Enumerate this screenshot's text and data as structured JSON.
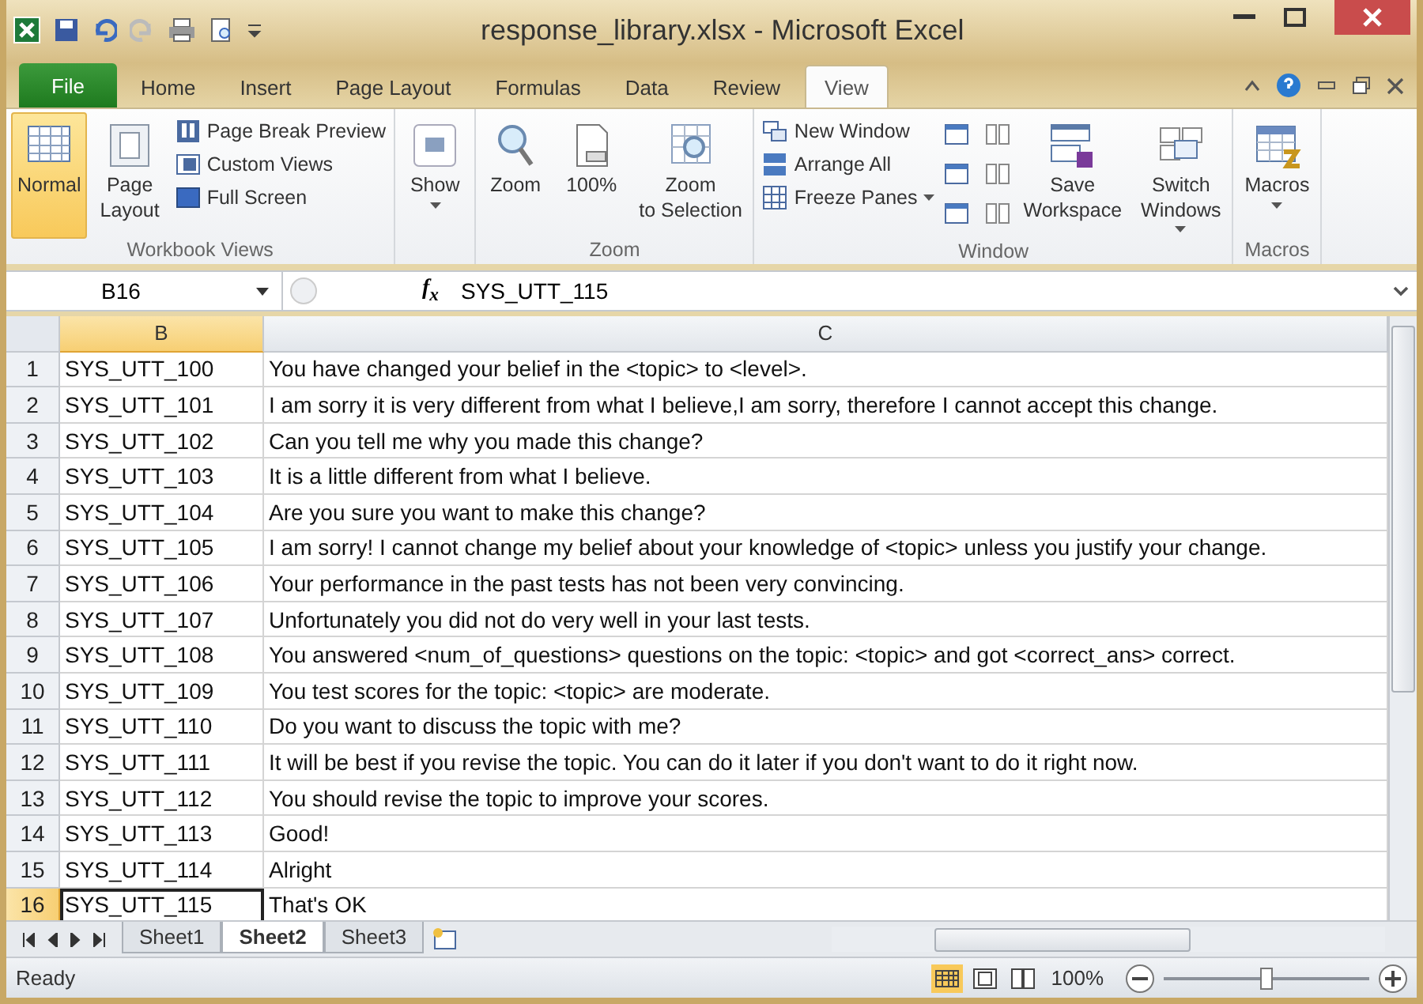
{
  "window": {
    "title": "response_library.xlsx - Microsoft Excel"
  },
  "tabs": [
    {
      "label": "File",
      "kind": "file",
      "selected": false
    },
    {
      "label": "Home",
      "kind": "tab",
      "selected": false
    },
    {
      "label": "Insert",
      "kind": "tab",
      "selected": false
    },
    {
      "label": "Page Layout",
      "kind": "tab",
      "selected": false
    },
    {
      "label": "Formulas",
      "kind": "tab",
      "selected": false
    },
    {
      "label": "Data",
      "kind": "tab",
      "selected": false
    },
    {
      "label": "Review",
      "kind": "tab",
      "selected": false
    },
    {
      "label": "View",
      "kind": "tab",
      "selected": true
    }
  ],
  "ribbon": [
    {
      "label": "Workbook Views",
      "items": [
        {
          "label": "Normal",
          "kind": "large",
          "selected": true
        },
        {
          "label": "Page Layout",
          "kind": "large",
          "selected": false
        },
        {
          "label": "Page Break Preview",
          "kind": "small",
          "selected": false
        },
        {
          "label": "Custom Views",
          "kind": "small",
          "selected": false
        },
        {
          "label": "Full Screen",
          "kind": "small",
          "selected": false
        }
      ]
    },
    {
      "items": [
        {
          "label": "Show",
          "kind": "large",
          "dropdown": true
        }
      ]
    },
    {
      "label": "Zoom",
      "items": [
        {
          "label": "Zoom",
          "kind": "large"
        },
        {
          "label": "100%",
          "kind": "large"
        },
        {
          "label": "Zoom to Selection",
          "kind": "large"
        }
      ]
    },
    {
      "label": "Window",
      "items": [
        {
          "label": "New Window",
          "kind": "small"
        },
        {
          "label": "Arrange All",
          "kind": "small"
        },
        {
          "label": "Freeze Panes",
          "kind": "small",
          "dropdown": true
        },
        {
          "kind": "iconcol"
        },
        {
          "label": "Save Workspace",
          "kind": "large"
        },
        {
          "label": "Switch Windows",
          "kind": "large",
          "dropdown": true
        }
      ]
    },
    {
      "label": "Macros",
      "items": [
        {
          "label": "Macros",
          "kind": "large",
          "dropdown": true
        }
      ]
    }
  ],
  "formula_bar": {
    "name_box": "B16",
    "function_label": "f$_{x}$",
    "formula": "SYS_UTT_115"
  },
  "columns": [
    {
      "label": "B",
      "selected": true
    },
    {
      "label": "C",
      "selected": false
    }
  ],
  "rows": [
    {
      "number": "1",
      "cells": [
        "SYS_UTT_100",
        "You have changed your belief in the <topic> to <level>."
      ],
      "selected": false
    },
    {
      "number": "2",
      "cells": [
        "SYS_UTT_101",
        "I am sorry it is very different from what I believe,I am sorry, therefore I cannot accept this change."
      ],
      "selected": false
    },
    {
      "number": "3",
      "cells": [
        "SYS_UTT_102",
        "Can you tell me why you made this change?"
      ],
      "selected": false
    },
    {
      "number": "4",
      "cells": [
        "SYS_UTT_103",
        "It is a little different from what I believe."
      ],
      "selected": false
    },
    {
      "number": "5",
      "cells": [
        "SYS_UTT_104",
        "Are you sure you want to make this change?"
      ],
      "selected": false
    },
    {
      "number": "6",
      "cells": [
        "SYS_UTT_105",
        "I am sorry! I cannot change my belief about your knowledge of <topic> unless you justify your change."
      ],
      "selected": false
    },
    {
      "number": "7",
      "cells": [
        "SYS_UTT_106",
        "Your performance in the past tests has not been very convincing."
      ],
      "selected": false
    },
    {
      "number": "8",
      "cells": [
        "SYS_UTT_107",
        "Unfortunately you did not do very well in your last tests."
      ],
      "selected": false
    },
    {
      "number": "9",
      "cells": [
        "SYS_UTT_108",
        "You answered <num_of_questions> questions on the topic: <topic> and got <correct_ans> correct."
      ],
      "selected": false
    },
    {
      "number": "10",
      "cells": [
        "SYS_UTT_109",
        "You test scores for the topic: <topic> are moderate."
      ],
      "selected": false
    },
    {
      "number": "11",
      "cells": [
        "SYS_UTT_110",
        "Do you want to discuss the topic with me?"
      ],
      "selected": false
    },
    {
      "number": "12",
      "cells": [
        "SYS_UTT_111",
        "It will be best if you revise the topic. You can do it later if you don't want to do it right now."
      ],
      "selected": false
    },
    {
      "number": "13",
      "cells": [
        "SYS_UTT_112",
        "You should revise the topic to improve your scores."
      ],
      "selected": false
    },
    {
      "number": "14",
      "cells": [
        "SYS_UTT_113",
        "Good!"
      ],
      "selected": false
    },
    {
      "number": "15",
      "cells": [
        "SYS_UTT_114",
        "Alright"
      ],
      "selected": false
    },
    {
      "number": "16",
      "cells": [
        "SYS_UTT_115",
        "That's OK"
      ],
      "selected": true
    }
  ],
  "sheet_tabs": [
    {
      "label": "Sheet1",
      "selected": false
    },
    {
      "label": "Sheet2",
      "selected": true
    },
    {
      "label": "Sheet3",
      "selected": false
    }
  ],
  "status_bar": {
    "status": "Ready",
    "zoom": "100%",
    "zoom_slider": {
      "level": 0.5
    }
  }
}
